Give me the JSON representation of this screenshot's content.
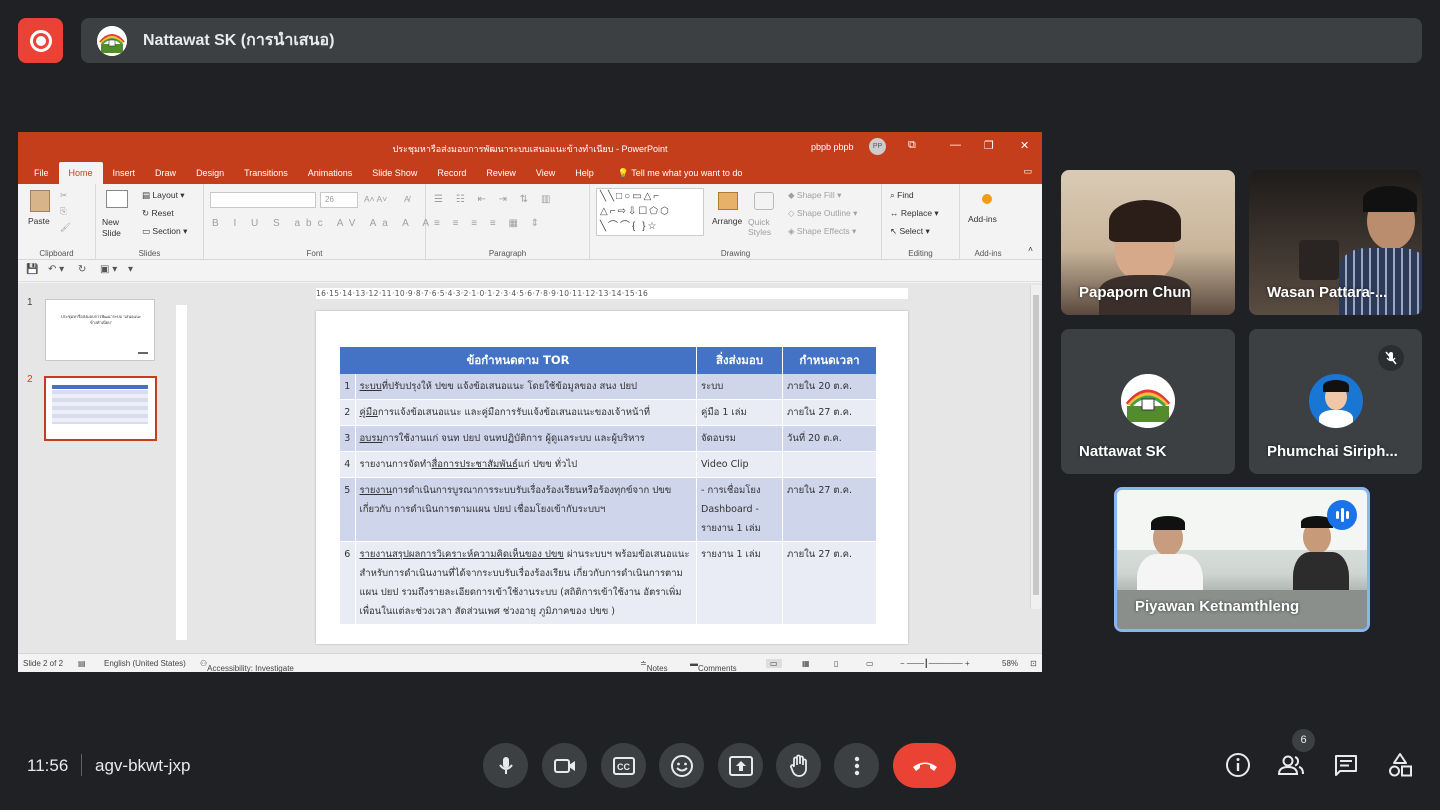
{
  "presenter": {
    "name": "Nattawat SK (การนำเสนอ)"
  },
  "powerpoint": {
    "doc_title": "ประชุมหารือส่งมอบการพัฒนาระบบเสนอแนะข้างทำเนียบ  -  PowerPoint",
    "user": "pbpb pbpb",
    "user_initials": "PP",
    "tabs": [
      "File",
      "Home",
      "Insert",
      "Draw",
      "Design",
      "Transitions",
      "Animations",
      "Slide Show",
      "Record",
      "Review",
      "View",
      "Help"
    ],
    "tell_me": "Tell me what you want to do",
    "ribbon": {
      "paste": "Paste",
      "clipboard": "Clipboard",
      "new_slide": "New Slide",
      "layout": "Layout",
      "reset": "Reset",
      "section": "Section",
      "slides": "Slides",
      "font_size": "26",
      "font": "Font",
      "paragraph": "Paragraph",
      "arrange": "Arrange",
      "quick_styles": "Quick Styles",
      "shape_fill": "Shape Fill",
      "shape_outline": "Shape Outline",
      "shape_effects": "Shape Effects",
      "drawing": "Drawing",
      "find": "Find",
      "replace": "Replace",
      "select": "Select",
      "editing": "Editing",
      "add_ins": "Add-ins",
      "add_ins_group": "Add-ins"
    },
    "thumbnails": [
      {
        "num": "1",
        "title": "ประชุมหารือส่งมอบการพัฒนาระบบ \"เสนอแนะข้างทำเนียบ\""
      },
      {
        "num": "2"
      }
    ],
    "ruler": "16·15·14·13·12·11·10·9·8·7·6·5·4·3·2·1·0·1·2·3·4·5·6·7·8·9·10·11·12·13·14·15·16",
    "table": {
      "headers": [
        "ข้อกำหนดตาม TOR",
        "สิ่งส่งมอบ",
        "กำหนดเวลา"
      ],
      "rows": [
        {
          "num": "1",
          "ul": "ระบบ",
          "text": "ที่ปรับปรุงให้ ปขข แจ้งข้อเสนอแนะ โดยใช้ข้อมูลของ สนง ปยป",
          "deliverable": "ระบบ",
          "deadline": "ภายใน 20 ต.ค."
        },
        {
          "num": "2",
          "ul": "คู่มือ",
          "text": "การแจ้งข้อเสนอแนะ และคู่มือการรับแจ้งข้อเสนอแนะของเจ้าหน้าที่",
          "deliverable": "คู่มือ 1 เล่ม",
          "deadline": "ภายใน 27 ต.ค."
        },
        {
          "num": "3",
          "ul": "อบรม",
          "text": "การใช้งานแก่ จนท ปยป จนท​ปฏิบัติการ ผู้ดูแลระบบ และผู้บริหาร",
          "deliverable": "จัดอบรม",
          "deadline": "วันที่ 20 ต.ค."
        },
        {
          "num": "4",
          "pre": "รายงานการจัดทำ",
          "ul": "สื่อการประชาสัมพันธ์",
          "text": "แก่ ปขข ทั่วไป",
          "deliverable": "Video Clip",
          "deadline": ""
        },
        {
          "num": "5",
          "ul": "รายงาน",
          "text": "การดำเนินการบูรณาการระบบรับเรื่องร้องเรียนหรือร้องทุกข์จาก ปขข เกี่ยวกับ การดำเนินการตามแผน ปยป เชื่อมโยงเข้ากับระบบฯ",
          "deliverable": "- การเชื่อมโยง Dashboard - รายงาน 1 เล่ม",
          "deadline": "ภายใน 27 ต.ค."
        },
        {
          "num": "6",
          "ul": "รายงานสรุปผลการวิเคราะห์ความคิดเห็นของ ปขข",
          "text": " ผ่านระบบฯ พร้อมข้อเสนอแนะสำหรับการดำเนินงานที่ได้จากระบบรับเรื่องร้องเรียน เกี่ยวกับการดำเนินการตามแผน ปยป รวมถึงรายละเอียดการเข้าใช้งานระบบ (สถิติการเข้าใช้งาน อัตราเพิ่มเพื่อนในแต่ละช่วงเวลา สัดส่วนเพศ ช่วงอายุ ภูมิภาคของ ปขข )",
          "deliverable": "รายงาน 1 เล่ม",
          "deadline": "ภายใน 27 ต.ค."
        }
      ]
    },
    "status": {
      "slide": "Slide 2 of 2",
      "language": "English (United States)",
      "accessibility": "Accessibility: Investigate",
      "notes": "Notes",
      "comments": "Comments",
      "zoom": "58%"
    }
  },
  "participants": [
    {
      "name": "Papaporn Chun"
    },
    {
      "name": "Wasan Pattara-..."
    },
    {
      "name": "Nattawat SK"
    },
    {
      "name": "Phumchai Siriph..."
    },
    {
      "name": "Piyawan Ketnamthleng"
    }
  ],
  "bottom_bar": {
    "time": "11:56",
    "meeting_code": "agv-bkwt-jxp",
    "participant_count": "6"
  },
  "colors": {
    "background": "#202124",
    "record_red": "#ea4335",
    "ppt_orange": "#c43e1c",
    "table_header": "#4472c4",
    "active_speaker": "#8ab4f8"
  }
}
